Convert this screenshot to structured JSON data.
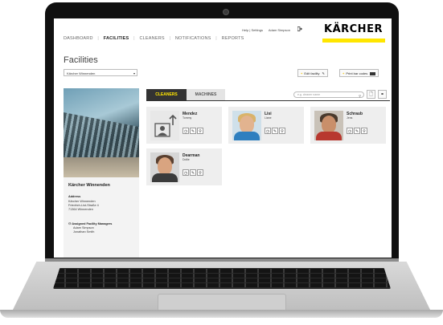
{
  "brand": {
    "name": "KÄRCHER",
    "accent": "#ffe600"
  },
  "nav": {
    "items": [
      {
        "label": "DASHBOARD",
        "active": false
      },
      {
        "label": "FACILITIES",
        "active": true
      },
      {
        "label": "CLEANERS",
        "active": false
      },
      {
        "label": "NOTIFICATIONS",
        "active": false
      },
      {
        "label": "REPORTS",
        "active": false
      }
    ],
    "separator": "|"
  },
  "util": {
    "help": "Help | Settings",
    "user": "Adam Simpson",
    "logout_icon": "logout-icon"
  },
  "page": {
    "title": "Facilities"
  },
  "facility_select": {
    "value": "Kärcher Winnenden"
  },
  "toolbar": {
    "edit": "Edit facility",
    "print": "Print bar codes"
  },
  "facility": {
    "name": "Kärcher Winnenden",
    "address_label": "Address",
    "address_lines": [
      "Kärcher Winnenden",
      "Friedrich-List-Straße 4",
      "71364 Winnenden"
    ],
    "managers_label": "Assigned Facility Managers",
    "managers": [
      "Adam Simpson",
      "Jonathan Smith"
    ]
  },
  "tabs": [
    {
      "label": "CLEANERS",
      "active": true
    },
    {
      "label": "MACHINES",
      "active": false
    }
  ],
  "search": {
    "placeholder": "e.g. cleaner name"
  },
  "cleaners": [
    {
      "last": "Mendez",
      "first": "Tommy",
      "photo": "placeholder"
    },
    {
      "last": "Lisi",
      "first": "Liane",
      "photo": "woman"
    },
    {
      "last": "Schraub",
      "first": "Jens",
      "photo": "man-beard"
    },
    {
      "last": "Dearman",
      "first": "Dollie",
      "photo": "man-smile"
    }
  ]
}
